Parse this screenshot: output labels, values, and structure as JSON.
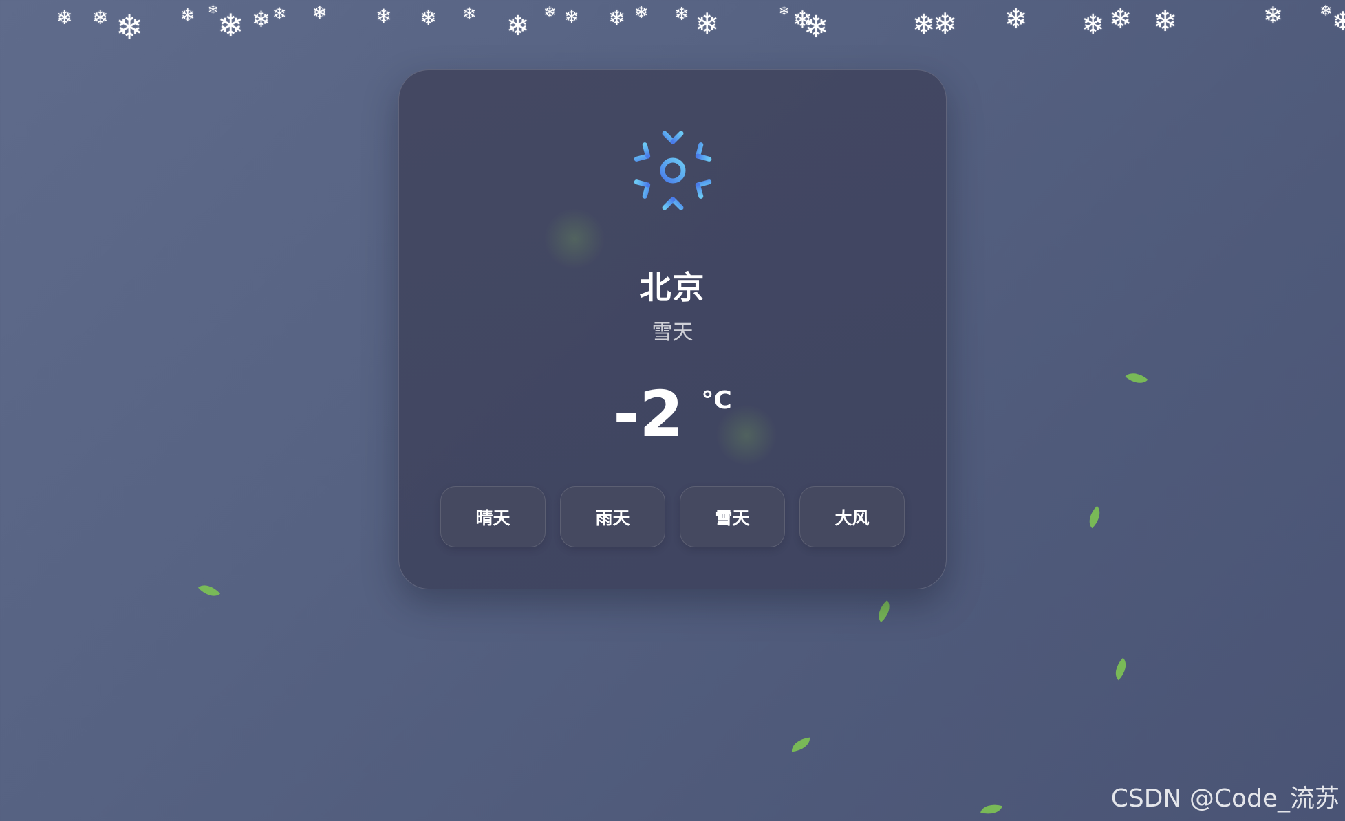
{
  "weather": {
    "city": "北京",
    "condition": "雪天",
    "temperature": "-2",
    "unit": "°C",
    "icon": "snowflake-icon"
  },
  "buttons": [
    {
      "label": "晴天"
    },
    {
      "label": "雨天"
    },
    {
      "label": "雪天"
    },
    {
      "label": "大风"
    }
  ],
  "watermark": "CSDN @Code_流苏",
  "decorations": {
    "snowflake_glyph": "❄",
    "leaf_color": "#7bbf55"
  }
}
